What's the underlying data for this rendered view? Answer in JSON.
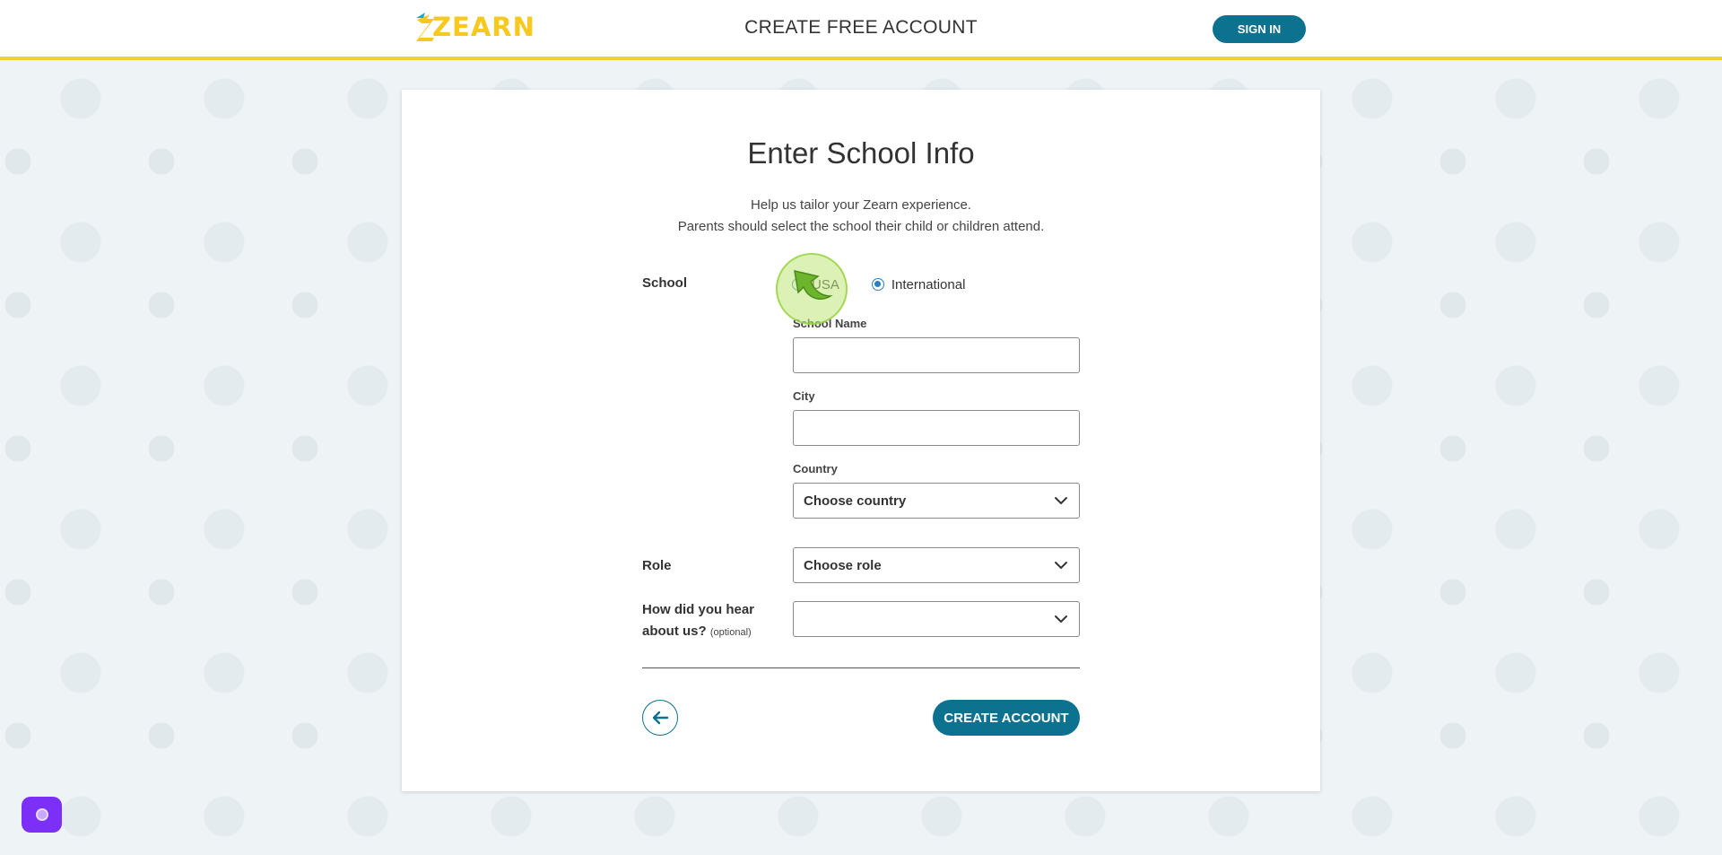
{
  "header": {
    "logo_text": "ZEARN",
    "title": "CREATE FREE ACCOUNT",
    "sign_in_label": "SIGN IN"
  },
  "form": {
    "title": "Enter School Info",
    "subtitle_line1": "Help us tailor your Zearn experience.",
    "subtitle_line2": "Parents should select the school their child or children attend.",
    "school_label": "School",
    "radio_options": [
      {
        "label": "USA",
        "checked": false
      },
      {
        "label": "International",
        "checked": true
      }
    ],
    "school_name_label": "School Name",
    "school_name_value": "",
    "city_label": "City",
    "city_value": "",
    "country_label": "Country",
    "country_value": "Choose country",
    "role_label": "Role",
    "role_value": "Choose role",
    "hear_label_line1": "How did you hear",
    "hear_label_line2": "about us?",
    "hear_optional": "(optional)",
    "hear_value": "",
    "create_button_label": "CREATE ACCOUNT"
  },
  "icons": {
    "back": "arrow-left-icon",
    "dropdown": "chevron-down-icon",
    "chat": "chat-icon"
  },
  "colors": {
    "primary": "#0d7190",
    "accent": "#f6cf2f",
    "radio": "#2a7fbf",
    "chat_widget": "#7b2ff7"
  }
}
